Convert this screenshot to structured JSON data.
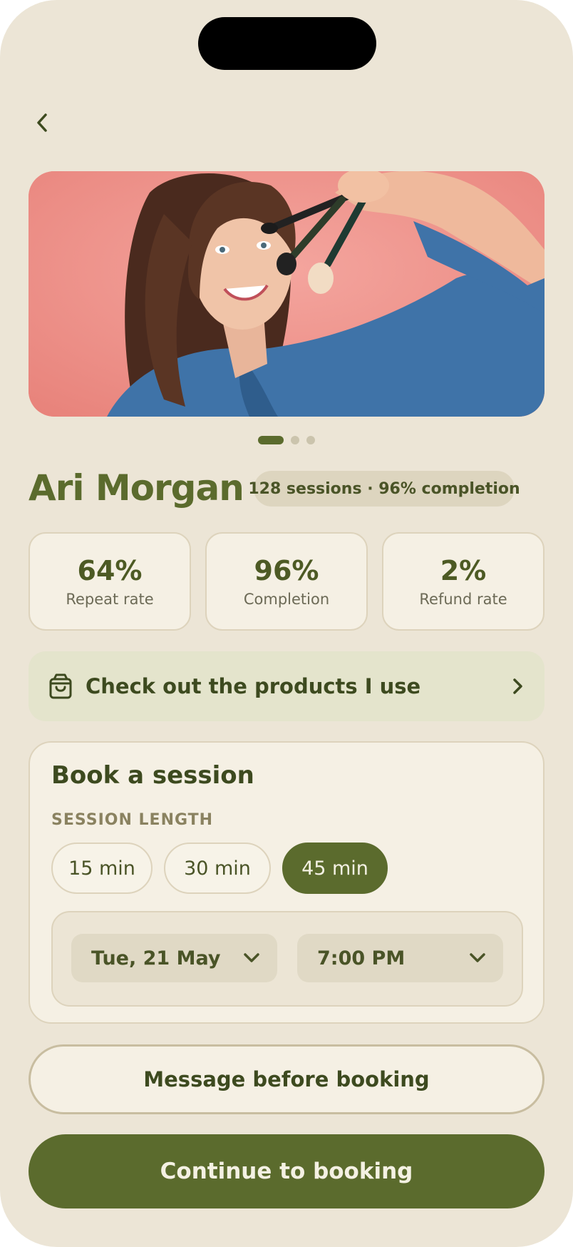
{
  "profile": {
    "name": "Ari Morgan",
    "summary": "128 sessions  · 96% completion",
    "photo_carousel": {
      "total": 3,
      "active_index": 1
    }
  },
  "stats": [
    {
      "value": "64%",
      "label": "Repeat rate"
    },
    {
      "value": "96%",
      "label": "Completion"
    },
    {
      "value": "2%",
      "label": "Refund rate"
    }
  ],
  "products_link": {
    "label": "Check out the products I use",
    "icon": "shopping-bag-icon"
  },
  "booking": {
    "title": "Book a session",
    "length_label": "SESSION LENGTH",
    "lengths": [
      "15 min",
      "30 min",
      "45 min"
    ],
    "selected_length": "45 min",
    "date": "Tue, 21 May",
    "time": "7:00 PM"
  },
  "actions": {
    "message_label": "Message before booking",
    "continue_label": "Continue to booking"
  },
  "colors": {
    "background": "#ece5d6",
    "accent": "#5b6b2d",
    "card": "#f5f0e4",
    "hero_backdrop": "#f0958e"
  }
}
